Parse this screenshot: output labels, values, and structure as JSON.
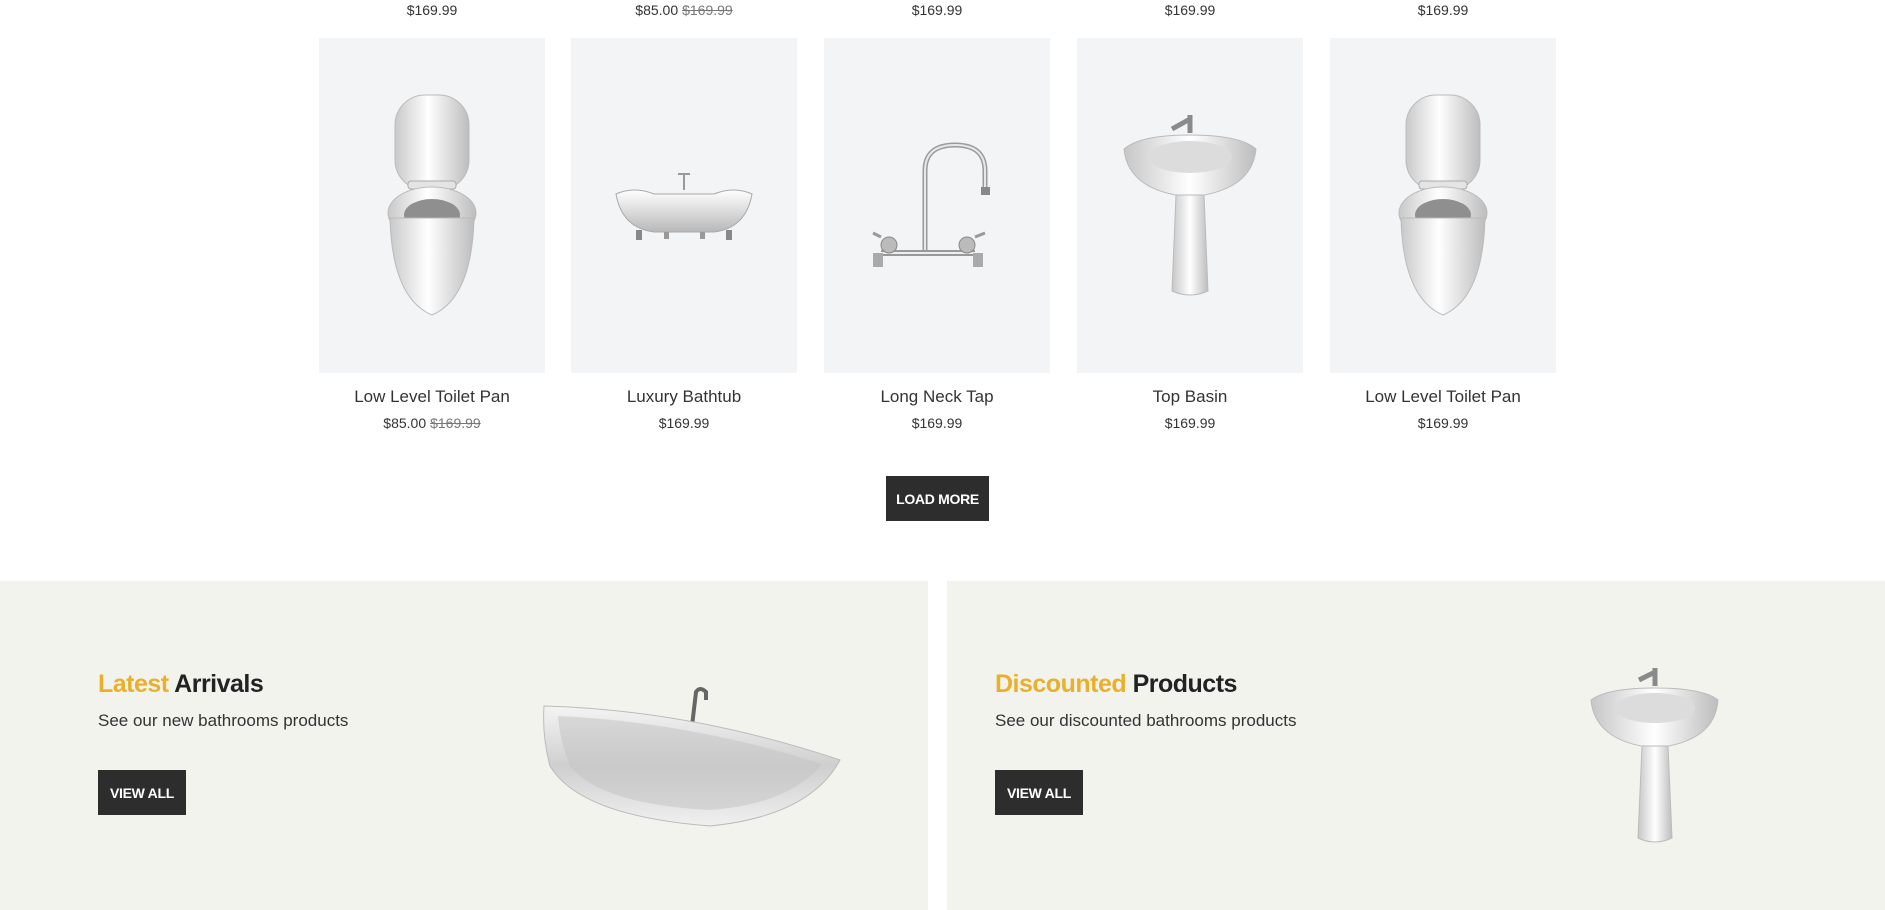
{
  "previous_row": {
    "prices": [
      {
        "price": "$169.99",
        "old_price": ""
      },
      {
        "price": "$85.00",
        "old_price": "$169.99"
      },
      {
        "price": "$169.99",
        "old_price": ""
      },
      {
        "price": "$169.99",
        "old_price": ""
      },
      {
        "price": "$169.99",
        "old_price": ""
      }
    ]
  },
  "products": [
    {
      "name": "Low Level Toilet Pan",
      "price": "$85.00",
      "old_price": "$169.99",
      "image": "toilet-image"
    },
    {
      "name": "Luxury Bathtub",
      "price": "$169.99",
      "old_price": "",
      "image": "bathtub-image"
    },
    {
      "name": "Long Neck Tap",
      "price": "$169.99",
      "old_price": "",
      "image": "tap-image"
    },
    {
      "name": "Top Basin",
      "price": "$169.99",
      "old_price": "",
      "image": "basin-image"
    },
    {
      "name": "Low Level Toilet Pan",
      "price": "$169.99",
      "old_price": "",
      "image": "toilet-image"
    }
  ],
  "load_more_label": "LOAD MORE",
  "banners": {
    "latest": {
      "title_accent": "Latest",
      "title_rest": " Arrivals",
      "subtitle": "See our new bathrooms products",
      "button_label": "VIEW ALL",
      "image": "bathtub-image"
    },
    "discounted": {
      "title_accent": "Discounted",
      "title_rest": " Products",
      "subtitle": "See our discounted bathrooms products",
      "button_label": "VIEW ALL",
      "image": "basin-image"
    }
  },
  "colors": {
    "accent": "#eab02c",
    "button_bg": "#2d2d2d",
    "banner_bg": "#f3f3ee",
    "thumb_bg": "#f3f4f6"
  }
}
